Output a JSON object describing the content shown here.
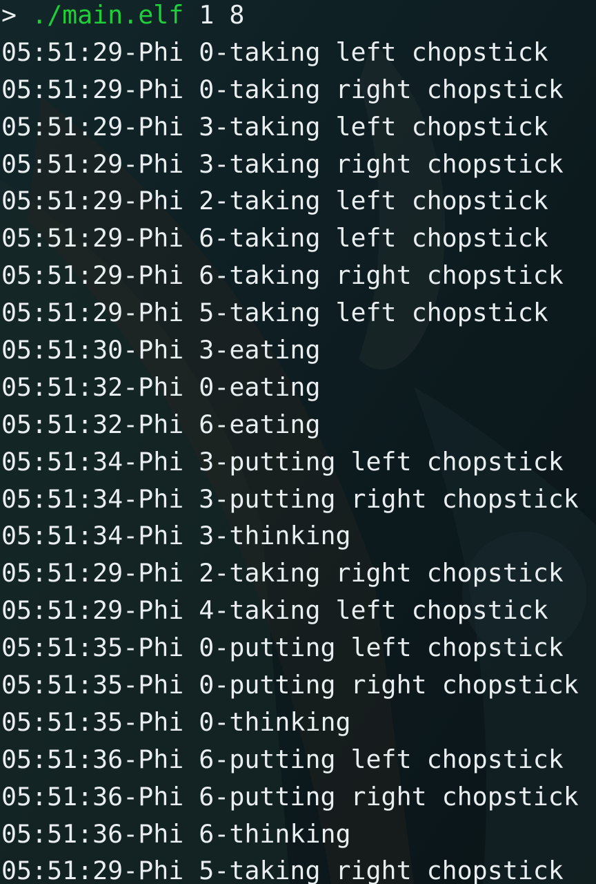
{
  "terminal": {
    "prompt": {
      "symbol": ">",
      "command": "./main.elf",
      "args": "1 8"
    },
    "lines": [
      "05:51:29-Phi 0-taking left chopstick",
      "05:51:29-Phi 0-taking right chopstick",
      "05:51:29-Phi 3-taking left chopstick",
      "05:51:29-Phi 3-taking right chopstick",
      "05:51:29-Phi 2-taking left chopstick",
      "05:51:29-Phi 6-taking left chopstick",
      "05:51:29-Phi 6-taking right chopstick",
      "05:51:29-Phi 5-taking left chopstick",
      "05:51:30-Phi 3-eating",
      "05:51:32-Phi 0-eating",
      "05:51:32-Phi 6-eating",
      "05:51:34-Phi 3-putting left chopstick",
      "05:51:34-Phi 3-putting right chopstick",
      "05:51:34-Phi 3-thinking",
      "05:51:29-Phi 2-taking right chopstick",
      "05:51:29-Phi 4-taking left chopstick",
      "05:51:35-Phi 0-putting left chopstick",
      "05:51:35-Phi 0-putting right chopstick",
      "05:51:35-Phi 0-thinking",
      "05:51:36-Phi 6-putting left chopstick",
      "05:51:36-Phi 6-putting right chopstick",
      "05:51:36-Phi 6-thinking",
      "05:51:29-Phi 5-taking right chopstick"
    ]
  },
  "colors": {
    "background": "#0e1a1d",
    "text": "#e9eef0",
    "command": "#1fcf3a"
  }
}
